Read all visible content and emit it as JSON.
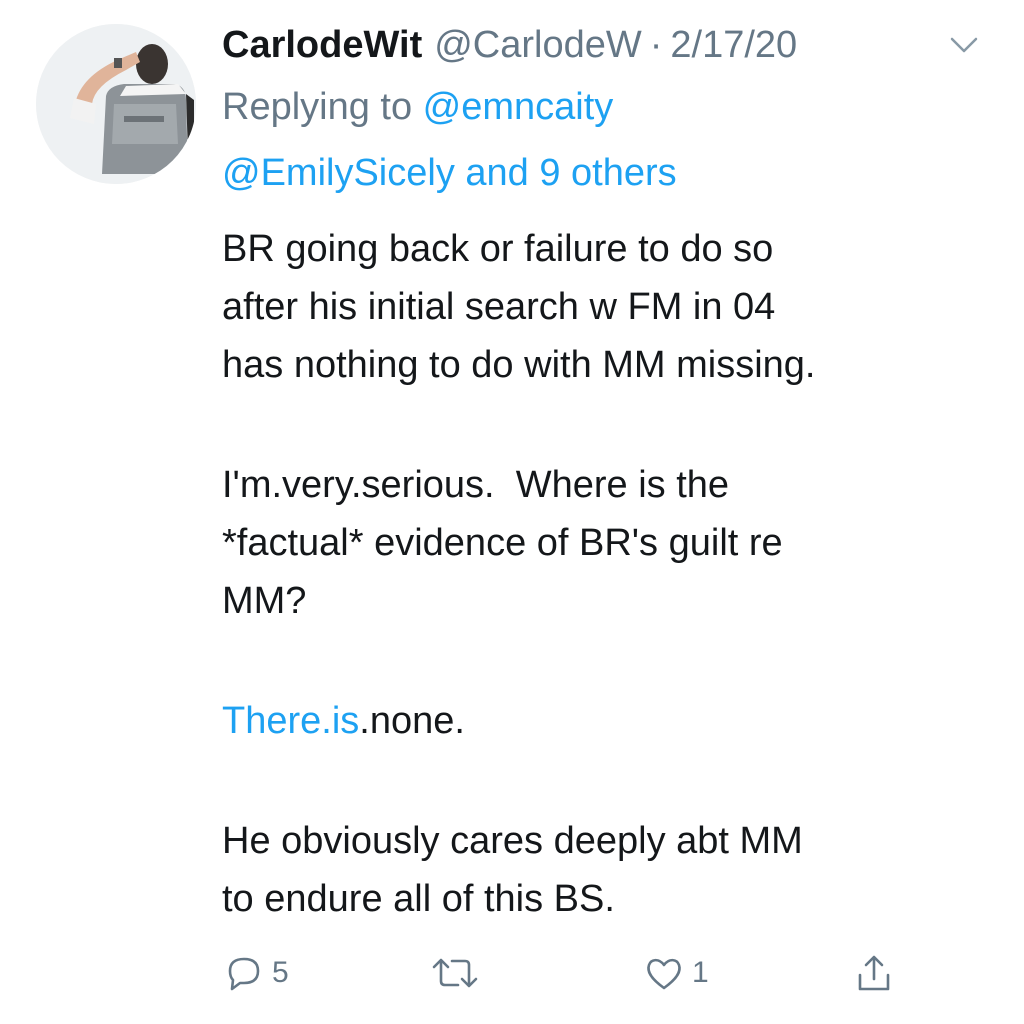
{
  "tweet": {
    "display_name": "CarlodeWit",
    "handle": "@CarlodeW",
    "separator": "·",
    "date": "2/17/20",
    "replying_prefix": "Replying to ",
    "replying_first": "@emncaity",
    "replying_second": "@EmilySicely and 9 others",
    "paragraph1": [
      "BR going back or failure to do so",
      "after his initial search w FM in 04",
      "has nothing to do with MM missing."
    ],
    "paragraph2": [
      "I'm.very.serious.  Where is the",
      "*factual* evidence of BR's guilt re",
      "MM?"
    ],
    "paragraph3_link": "There.is",
    "paragraph3_rest": ".none.",
    "paragraph4": [
      "He obviously cares deeply abt MM",
      "to endure all of this BS."
    ]
  },
  "actions": {
    "reply_icon": "reply-icon",
    "reply_count": "5",
    "retweet_icon": "retweet-icon",
    "like_icon": "heart-icon",
    "like_count": "1",
    "share_icon": "share-icon"
  },
  "colors": {
    "text": "#14171a",
    "muted": "#657786",
    "link": "#1da1f2"
  }
}
